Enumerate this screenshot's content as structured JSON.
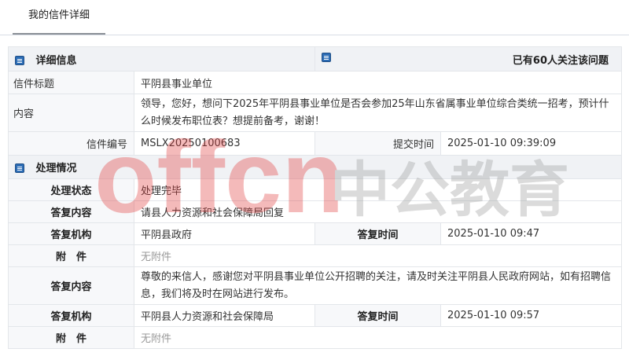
{
  "tab": {
    "label": "我的信件详细"
  },
  "detail": {
    "header": "详细信息",
    "followers": "已有60人关注该问题",
    "title_label": "信件标题",
    "title": "平阴县事业单位",
    "content_label": "内容",
    "content": "领导，您好，想问下2025年平阴县事业单位是否会参加25年山东省属事业单位综合类统一招考，预计什么时候发布职位表？想提前备考，谢谢！",
    "number_label": "信件编号",
    "number": "MSLX20250100683",
    "submit_label": "提交时间",
    "submit_time": "2025-01-10 09:39:09"
  },
  "processing": {
    "header": "处理情况",
    "status_label": "处理状态",
    "status": "处理完毕",
    "reply_content_label": "答复内容",
    "reply_org_label": "答复机构",
    "reply_time_label": "答复时间",
    "attach_label": "附　件",
    "replies": [
      {
        "content": "请县人力资源和社会保障局回复",
        "org": "平阴县政府",
        "time": "2025-01-10 09:47",
        "attach": "无附件"
      },
      {
        "content": "尊敬的来信人，感谢您对平阴县事业单位公开招聘的关注，请及时关注平阴县人民政府网站，如有招聘信息，我们将及时在网站进行发布。",
        "org": "平阴县人力资源和社会保障局",
        "time": "2025-01-10 09:57",
        "attach": "无附件"
      }
    ]
  },
  "watermark": {
    "latin": "offcn",
    "chinese": "中公教育"
  },
  "colors": {
    "icon": "#2d6db5",
    "watermark_red": "#e23b3b",
    "watermark_gray": "#9a9a9a"
  }
}
